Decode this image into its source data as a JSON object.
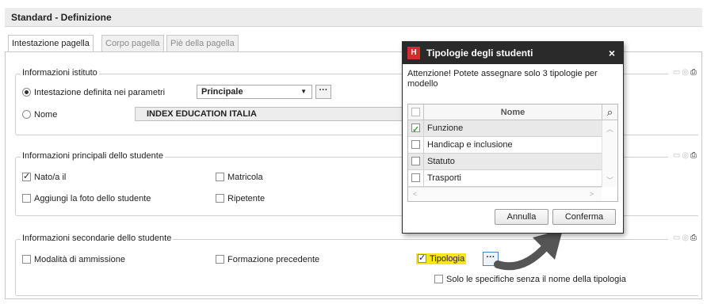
{
  "header": {
    "title": "Standard - Definizione"
  },
  "tabs": [
    {
      "label": "Intestazione pagella",
      "active": true
    },
    {
      "label": "Corpo pagella",
      "active": false
    },
    {
      "label": "Piè della pagella",
      "active": false
    }
  ],
  "group1": {
    "title": "Informazioni istituto",
    "radio1_label": "Intestazione definita nei parametri",
    "radio1_selected": true,
    "select_value": "Principale",
    "dots": "···",
    "radio2_label": "Nome",
    "name_value": "INDEX EDUCATION ITALIA"
  },
  "group2": {
    "title": "Informazioni principali dello studente",
    "items": [
      {
        "label": "Nato/a il",
        "checked": true
      },
      {
        "label": "Matricola",
        "checked": false
      },
      {
        "label": "Aggiungi la foto dello studente",
        "checked": false
      },
      {
        "label": "Ripetente",
        "checked": false
      }
    ]
  },
  "group3": {
    "title": "Informazioni secondarie dello studente",
    "items": [
      {
        "label": "Modalità di ammissione",
        "checked": false
      },
      {
        "label": "Formazione precedente",
        "checked": false
      },
      {
        "label": "Tipologia",
        "checked": true
      },
      {
        "label": "Solo le specifiche senza il nome della tipologia",
        "checked": false
      }
    ],
    "dots": "···"
  },
  "modal": {
    "logo": "H",
    "title": "Tipologie degli studenti",
    "close": "×",
    "warning": "Attenzione! Potete assegnare solo 3 tipologie per modello",
    "column_header": "Nome",
    "rows": [
      {
        "label": "Funzione",
        "checked": true
      },
      {
        "label": "Handicap e inclusione",
        "checked": false
      },
      {
        "label": "Statuto",
        "checked": false
      },
      {
        "label": "Trasporti",
        "checked": false
      }
    ],
    "cancel_label": "Annulla",
    "confirm_label": "Conferma"
  },
  "colors": {
    "highlight": "#f6e61a",
    "modal_title_bg": "#2a2a2a",
    "logo_bg": "#d42b2b",
    "arrow": "#555555"
  },
  "icons": [
    "printer-icon",
    "group-settings-icon",
    "search-icon",
    "close-icon",
    "chevron-down-icon",
    "arrow-icon"
  ]
}
